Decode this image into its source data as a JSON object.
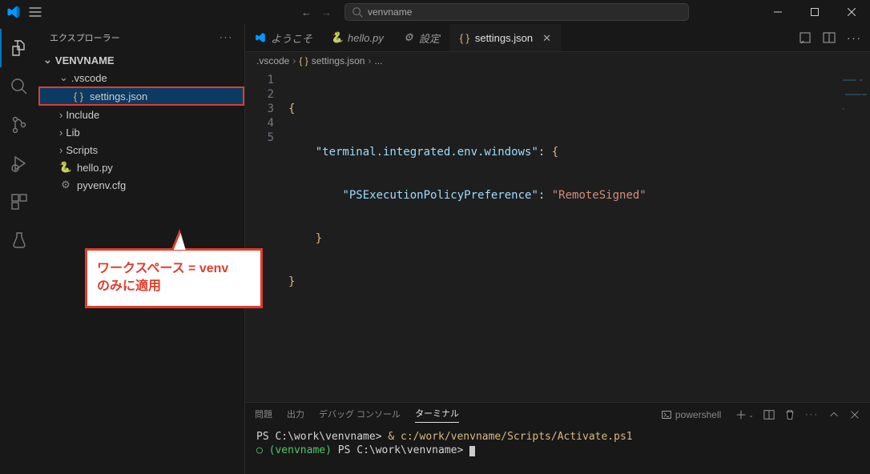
{
  "title": {
    "search_text": "venvname"
  },
  "activity": [
    "files",
    "search",
    "source-control",
    "run",
    "extensions",
    "testing"
  ],
  "sidebar": {
    "title": "エクスプローラー",
    "root": "VENVNAME",
    "items": [
      {
        "label": ".vscode",
        "type": "folder",
        "open": true,
        "depth": 1
      },
      {
        "label": "settings.json",
        "type": "json",
        "depth": 2,
        "selected": true
      },
      {
        "label": "Include",
        "type": "folder",
        "open": false,
        "depth": 1
      },
      {
        "label": "Lib",
        "type": "folder",
        "open": false,
        "depth": 1
      },
      {
        "label": "Scripts",
        "type": "folder",
        "open": false,
        "depth": 1
      },
      {
        "label": "hello.py",
        "type": "python",
        "depth": 1
      },
      {
        "label": "pyvenv.cfg",
        "type": "cfg",
        "depth": 1
      }
    ]
  },
  "annotation": {
    "line1": "ワークスペース = venv",
    "line2": "のみに適用"
  },
  "tabs": [
    {
      "label": "ようこそ",
      "icon": "vscode"
    },
    {
      "label": "hello.py",
      "icon": "python"
    },
    {
      "label": "設定",
      "icon": "gear"
    },
    {
      "label": "settings.json",
      "icon": "json",
      "active": true
    }
  ],
  "breadcrumbs": {
    "a": ".vscode",
    "b": "settings.json",
    "c": "..."
  },
  "code": {
    "key1": "\"terminal.integrated.env.windows\"",
    "key2": "\"PSExecutionPolicyPreference\"",
    "val2": "\"RemoteSigned\"",
    "line_numbers": [
      "1",
      "2",
      "3",
      "4",
      "5"
    ]
  },
  "panel": {
    "tabs": [
      "問題",
      "出力",
      "デバッグ コンソール",
      "ターミナル"
    ],
    "active_tab": 3,
    "term_kind": "powershell"
  },
  "terminal": {
    "prompt1": "PS C:\\work\\venvname>",
    "cmd1a": " & ",
    "cmd1b": "c:/work/venvname/Scripts/Activate.ps1",
    "dot": "○",
    "env": "(venvname)",
    "prompt2": " PS C:\\work\\venvname> "
  }
}
